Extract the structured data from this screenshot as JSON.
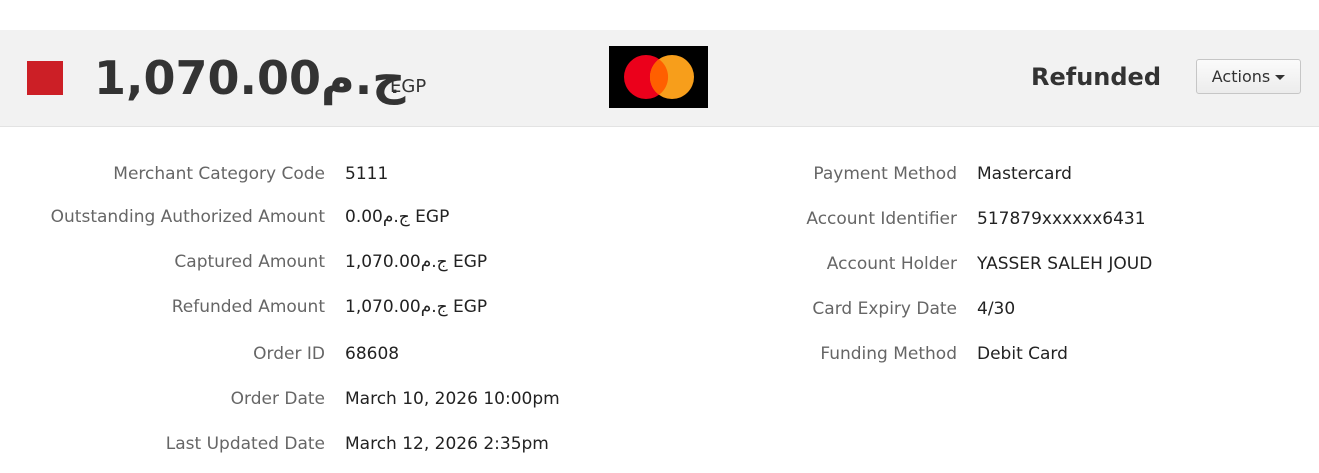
{
  "header": {
    "status_color": "#cc1f26",
    "amount": "1,070.00ج.م",
    "currency": "EGP",
    "card_brand_icon": "mastercard-logo",
    "status": "Refunded",
    "actions_label": "Actions"
  },
  "details_left": [
    {
      "label": "Merchant Category Code",
      "value": "5111"
    },
    {
      "label": "Outstanding Authorized Amount",
      "value": "0.00ج.م EGP"
    },
    {
      "label": "Captured Amount",
      "value": "1,070.00ج.م EGP"
    },
    {
      "label": "Refunded Amount",
      "value": "1,070.00ج.م EGP"
    },
    {
      "label": "Order ID",
      "value": "68608"
    },
    {
      "label": "Order Date",
      "value": "March 10, 2026 10:00pm"
    },
    {
      "label": "Last Updated Date",
      "value": "March 12, 2026 2:35pm"
    }
  ],
  "details_right": [
    {
      "label": "Payment Method",
      "value": "Mastercard"
    },
    {
      "label": "Account Identifier",
      "value": "517879xxxxxx6431"
    },
    {
      "label": "Account Holder",
      "value": "YASSER SALEH JOUD"
    },
    {
      "label": "Card Expiry Date",
      "value": "4/30"
    },
    {
      "label": "Funding Method",
      "value": "Debit Card"
    }
  ],
  "colors": {
    "header_bg": "#f2f2f2",
    "mastercard_red": "#eb001b",
    "mastercard_orange": "#f79e1b"
  }
}
